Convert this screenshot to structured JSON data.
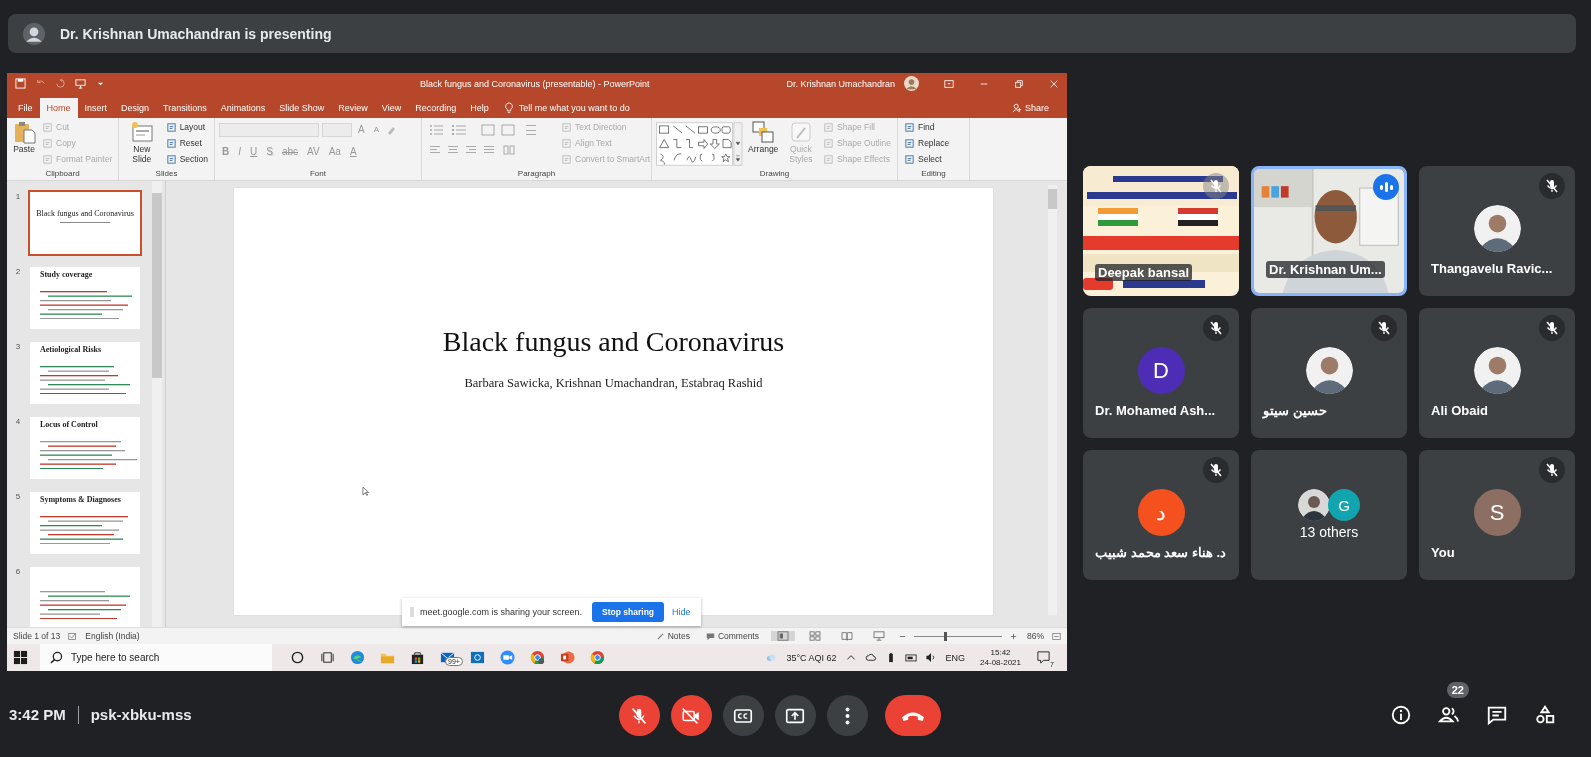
{
  "presenter_banner": {
    "text": "Dr. Krishnan Umachandran is presenting"
  },
  "powerpoint": {
    "title": "Black fungus and Coronavirus (presentable)  -  PowerPoint",
    "user": "Dr. Krishnan Umachandran",
    "tabs": [
      {
        "label": "File",
        "selected": false
      },
      {
        "label": "Home",
        "selected": true
      },
      {
        "label": "Insert",
        "selected": false
      },
      {
        "label": "Design",
        "selected": false
      },
      {
        "label": "Transitions",
        "selected": false
      },
      {
        "label": "Animations",
        "selected": false
      },
      {
        "label": "Slide Show",
        "selected": false
      },
      {
        "label": "Review",
        "selected": false
      },
      {
        "label": "View",
        "selected": false
      },
      {
        "label": "Recording",
        "selected": false
      },
      {
        "label": "Help",
        "selected": false
      }
    ],
    "tell_me": "Tell me what you want to do",
    "share": "Share",
    "ribbon_groups": [
      {
        "kind": "clipboard",
        "label": "Clipboard",
        "big": [
          {
            "label": "Paste",
            "disabled": false
          }
        ],
        "small": [
          {
            "label": "Cut",
            "disabled": true
          },
          {
            "label": "Copy",
            "disabled": true
          },
          {
            "label": "Format Painter",
            "disabled": true
          }
        ]
      },
      {
        "kind": "slides",
        "label": "Slides",
        "big": [
          {
            "label": "New Slide",
            "disabled": false
          }
        ],
        "small": [
          {
            "label": "Layout",
            "disabled": false
          },
          {
            "label": "Reset",
            "disabled": false
          },
          {
            "label": "Section",
            "disabled": false
          }
        ]
      },
      {
        "kind": "font",
        "label": "Font",
        "size_buttons": [
          "A",
          "A"
        ],
        "format_buttons": [
          "B",
          "I",
          "U",
          "S",
          "abc",
          "AV",
          "Aa",
          "A"
        ]
      },
      {
        "kind": "paragraph",
        "label": "Paragraph",
        "small": [
          {
            "label": "Text Direction",
            "disabled": true
          },
          {
            "label": "Align Text",
            "disabled": true
          },
          {
            "label": "Convert to SmartArt",
            "disabled": true
          }
        ]
      },
      {
        "kind": "drawing",
        "label": "Drawing",
        "big": [
          {
            "label": "Arrange",
            "disabled": false
          },
          {
            "label": "Quick Styles",
            "disabled": true
          }
        ],
        "small": [
          {
            "label": "Shape Fill",
            "disabled": true
          },
          {
            "label": "Shape Outline",
            "disabled": true
          },
          {
            "label": "Shape Effects",
            "disabled": true
          }
        ]
      },
      {
        "kind": "editing",
        "label": "Editing",
        "small": [
          {
            "label": "Find",
            "disabled": false
          },
          {
            "label": "Replace",
            "disabled": false
          },
          {
            "label": "Select",
            "disabled": false
          }
        ]
      }
    ],
    "slides": [
      {
        "number": "1",
        "title": "Black fungus and Coronavirus",
        "selected": true
      },
      {
        "number": "2",
        "title": "Study coverage",
        "selected": false
      },
      {
        "number": "3",
        "title": "Aetiological Risks",
        "selected": false
      },
      {
        "number": "4",
        "title": "Locus of Control",
        "selected": false
      },
      {
        "number": "5",
        "title": "Symptoms & Diagnoses",
        "selected": false
      },
      {
        "number": "6",
        "selected": false
      }
    ],
    "slide": {
      "title": "Black fungus and Coronavirus",
      "authors": "Barbara Sawicka, Krishnan Umachandran, Estabraq Rashid"
    },
    "share_notice": {
      "text": "meet.google.com is sharing your screen.",
      "stop": "Stop sharing",
      "hide": "Hide"
    },
    "status_bar": {
      "slide": "Slide 1 of 13",
      "language": "English (India)",
      "notes": "Notes",
      "comments": "Comments",
      "zoom": {
        "level": 0.35
      },
      "zoom_text": "86%"
    },
    "taskbar": {
      "search_placeholder": "Type here to search",
      "mail_badge": "99+",
      "weather": "35°C  AQI 62",
      "language": "ENG",
      "time": "15:42",
      "date": "24-08-2021",
      "notification_count": "7"
    }
  },
  "tiles": [
    {
      "kind": "video",
      "name": "Deepak bansal",
      "muted": true,
      "speaking": false
    },
    {
      "kind": "video",
      "name": "Dr. Krishnan Um...",
      "muted": false,
      "speaking": true
    },
    {
      "name": "Thangavelu Ravic...",
      "muted": true,
      "speaking": false
    },
    {
      "kind": "initial",
      "name": "Dr. Mohamed Ash...",
      "initial": "D",
      "color": "#4e2db6",
      "muted": true,
      "speaking": false
    },
    {
      "name": "حسين سيتو",
      "muted": true,
      "speaking": false
    },
    {
      "name": "Ali Obaid",
      "muted": true,
      "speaking": false
    },
    {
      "kind": "initial",
      "name": "د. هناء سعد محمد شبيب",
      "initial": "د",
      "color": "#f4511e",
      "muted": true,
      "speaking": false
    },
    {
      "kind": "group",
      "name": "13 others",
      "initial": "G",
      "color": "#12a4af",
      "muted": false,
      "speaking": false
    },
    {
      "kind": "initial",
      "name": "You",
      "initial": "S",
      "color": "#8d6e63",
      "muted": true,
      "speaking": false
    }
  ],
  "bottom_bar": {
    "time": "3:42 PM",
    "meeting_code": "psk-xbku-mss",
    "controls": [
      {
        "kind": "mic",
        "on": false
      },
      {
        "kind": "camera",
        "on": false
      },
      {
        "kind": "captions",
        "on": false
      },
      {
        "kind": "present"
      },
      {
        "kind": "more"
      },
      {
        "kind": "leave"
      }
    ],
    "side_buttons": [
      {
        "kind": "info"
      },
      {
        "kind": "people",
        "badge": "22"
      },
      {
        "kind": "chat"
      },
      {
        "kind": "activities"
      }
    ]
  }
}
